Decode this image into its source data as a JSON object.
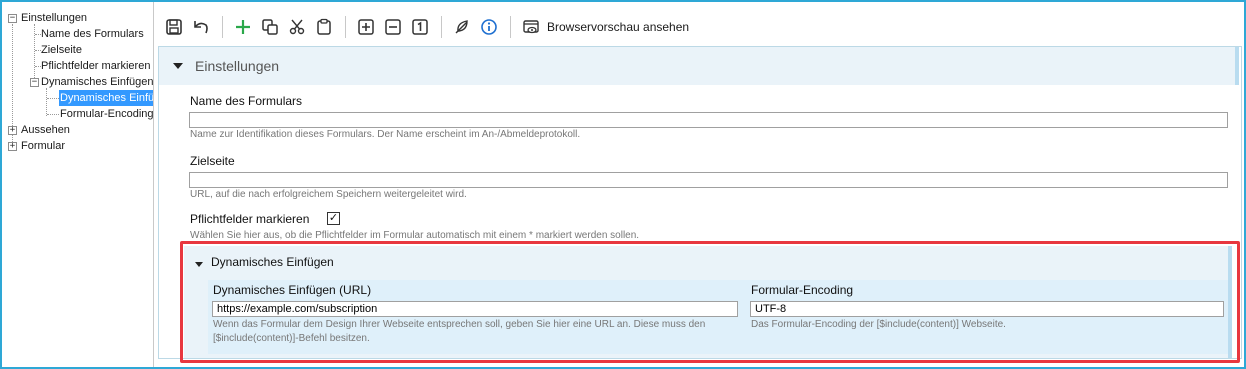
{
  "tree": {
    "items": [
      {
        "label": "Einstellungen",
        "toggle": "−"
      },
      {
        "label": "Name des Formulars"
      },
      {
        "label": "Zielseite"
      },
      {
        "label": "Pflichtfelder markieren"
      },
      {
        "label": "Dynamisches Einfügen",
        "toggle": "−"
      },
      {
        "label": "Dynamisches Einfügen",
        "selected": true
      },
      {
        "label": "Formular-Encoding"
      },
      {
        "label": "Aussehen",
        "toggle": "+"
      },
      {
        "label": "Formular",
        "toggle": "+"
      }
    ]
  },
  "toolbar": {
    "buttons": [
      "save-icon",
      "undo-icon",
      "add-icon",
      "copy-icon",
      "cut-icon",
      "paste-icon",
      "expand-icon",
      "collapse-icon",
      "number-one-icon",
      "feather-icon",
      "info-icon"
    ],
    "preview_label": "Browservorschau ansehen"
  },
  "section": {
    "title": "Einstellungen",
    "name_label": "Name des Formulars",
    "name_value": "",
    "name_help": "Name zur Identifikation dieses Formulars. Der Name erscheint im An-/Abmeldeprotokoll.",
    "target_label": "Zielseite",
    "target_value": "",
    "target_help": "URL, auf die nach erfolgreichem Speichern weitergeleitet wird.",
    "required_label": "Pflichtfelder markieren",
    "required_checked": true,
    "required_help": "Wählen Sie hier aus, ob die Pflichtfelder im Formular automatisch mit einem * markiert werden sollen."
  },
  "subsection": {
    "title": "Dynamisches Einfügen",
    "url_label": "Dynamisches Einfügen (URL)",
    "url_value": "https://example.com/subscription",
    "url_help_1": "Wenn das Formular dem Design Ihrer Webseite entsprechen soll, geben Sie hier eine URL an. Diese muss den",
    "url_help_2": "[$include(content)]-Befehl besitzen.",
    "encoding_label": "Formular-Encoding",
    "encoding_value": "UTF-8",
    "encoding_help": "Das Formular-Encoding der [$include(content)] Webseite."
  },
  "colors": {
    "frame": "#2ea8d6",
    "highlight": "#e8373f",
    "section_bg": "#eaf3f9",
    "selected": "#3399ff",
    "add_icon": "#2aa84a",
    "info_icon": "#1e6fd0"
  }
}
